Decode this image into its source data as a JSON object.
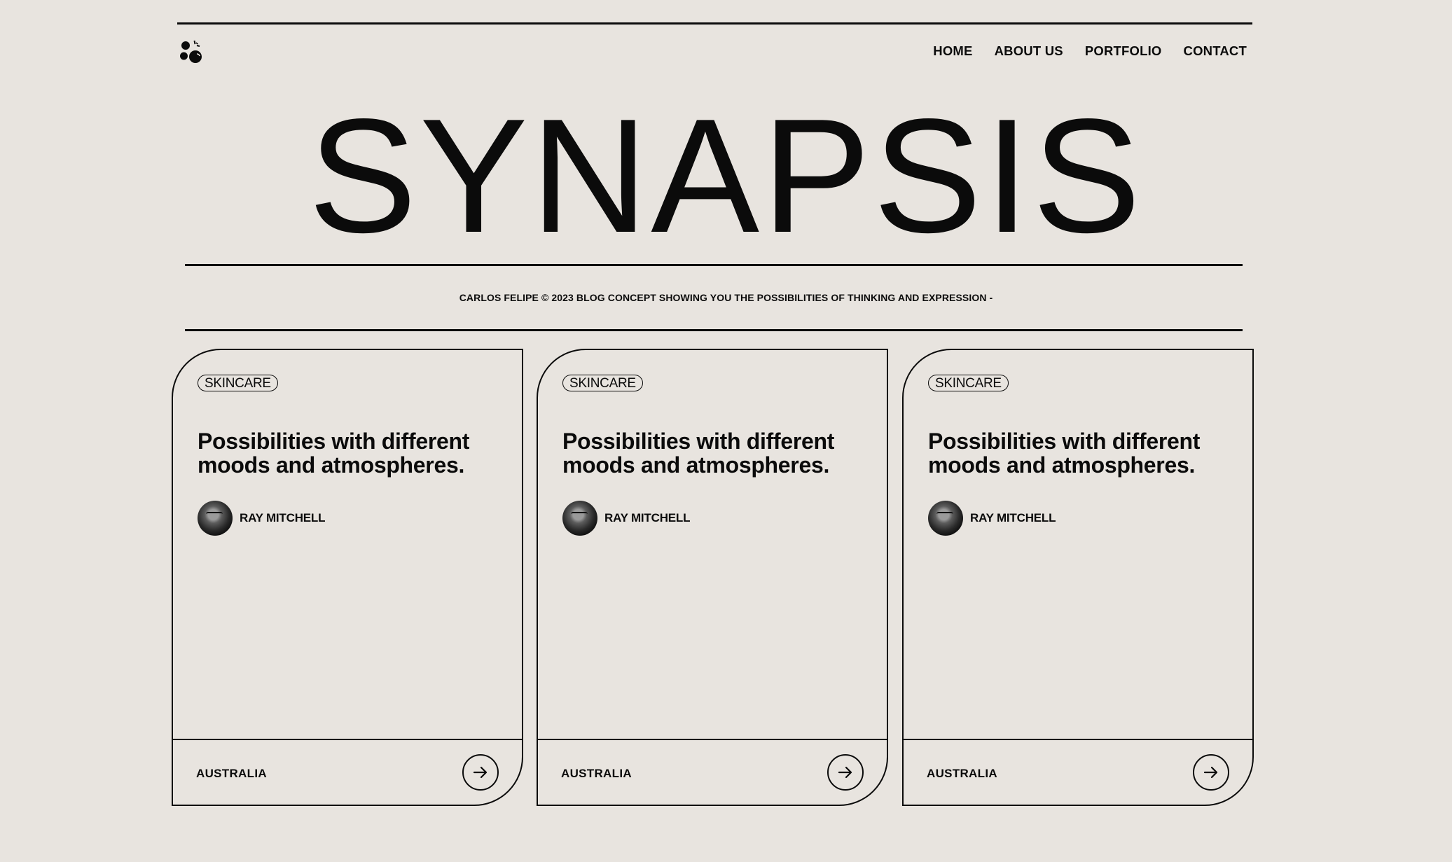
{
  "header": {
    "logo": "bubbles-logo-icon",
    "nav": [
      {
        "label": "HOME"
      },
      {
        "label": "ABOUT US"
      },
      {
        "label": "PORTFOLIO"
      },
      {
        "label": "CONTACT"
      }
    ]
  },
  "hero": {
    "title": "SYNAPSIS",
    "subtitle": "CARLOS FELIPE © 2023 BLOG CONCEPT SHOWING YOU THE POSSIBILITIES OF THINKING AND EXPRESSION -"
  },
  "cards": [
    {
      "tag": "SKINCARE",
      "title": "Possibilities with different moods and atmospheres.",
      "author": "RAY MITCHELL",
      "location": "AUSTRALIA",
      "action_icon": "arrow-right-icon"
    },
    {
      "tag": "SKINCARE",
      "title": "Possibilities with different moods and atmospheres.",
      "author": "RAY MITCHELL",
      "location": "AUSTRALIA",
      "action_icon": "arrow-right-icon"
    },
    {
      "tag": "SKINCARE",
      "title": "Possibilities with different moods and atmospheres.",
      "author": "RAY MITCHELL",
      "location": "AUSTRALIA",
      "action_icon": "arrow-right-icon"
    }
  ],
  "colors": {
    "background": "#e8e4df",
    "ink": "#0b0b0b"
  }
}
